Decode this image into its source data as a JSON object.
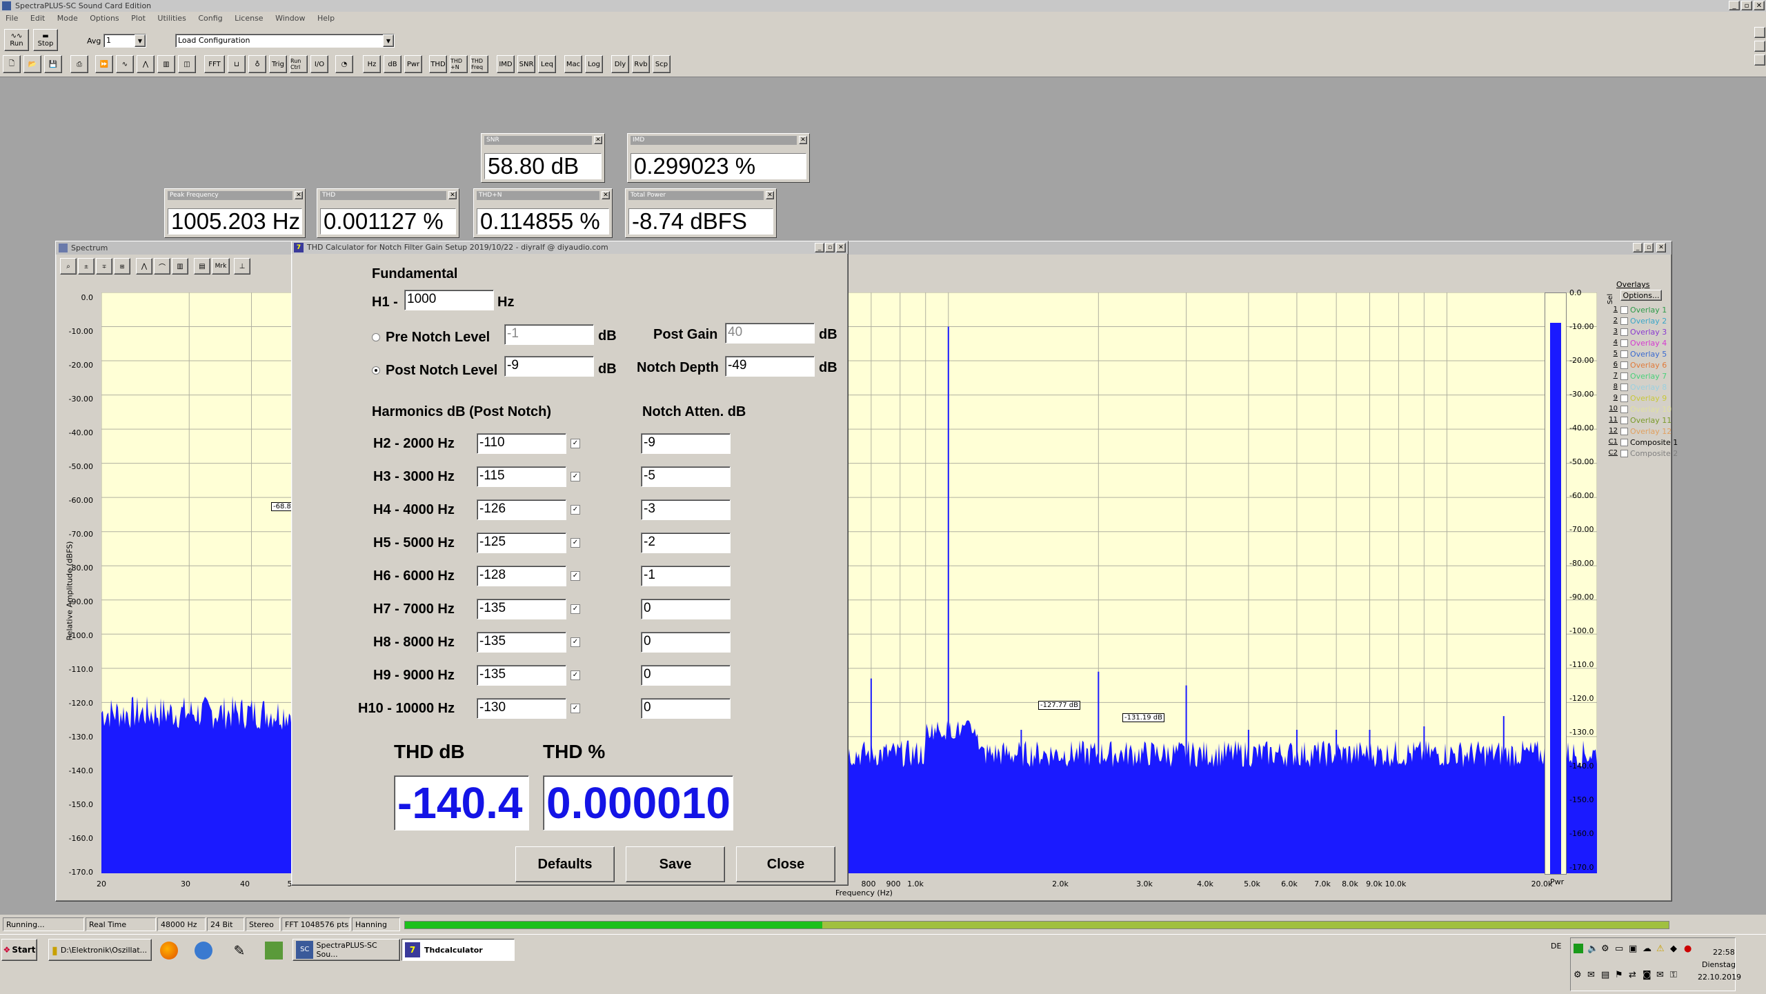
{
  "app_title": "SpectraPLUS-SC Sound Card Edition",
  "menu": [
    "File",
    "Edit",
    "Mode",
    "Options",
    "Plot",
    "Utilities",
    "Config",
    "License",
    "Window",
    "Help"
  ],
  "toolbar": {
    "run_label": "Run",
    "stop_label": "Stop",
    "avg_label": "Avg",
    "avg_value": "1",
    "config_value": "Load Configuration",
    "buttons": [
      "FFT",
      "Trig",
      "Run Ctrl",
      "I/O",
      "Hz",
      "dB",
      "Pwr",
      "THD",
      "THD +N",
      "THD Freq",
      "IMD",
      "SNR",
      "Leq",
      "Mac",
      "Log",
      "Dly",
      "Rvb",
      "Scp"
    ]
  },
  "meters": {
    "snr": {
      "title": "SNR",
      "value": "58.80 dB"
    },
    "imd": {
      "title": "IMD",
      "value": "0.299023 %"
    },
    "peak": {
      "title": "Peak Frequency",
      "value": "1005.203 Hz"
    },
    "thd": {
      "title": "THD",
      "value": "0.001127 %"
    },
    "thdn": {
      "title": "THD+N",
      "value": "0.114855 %"
    },
    "power": {
      "title": "Total Power",
      "value": "-8.74 dBFS"
    }
  },
  "spectrum": {
    "title": "Spectrum",
    "ylabel": "Relative Amplitude (dBFS)",
    "xlabel": "Frequency (Hz)",
    "yticks": [
      "0.0",
      "-10.00",
      "-20.00",
      "-30.00",
      "-40.00",
      "-50.00",
      "-60.00",
      "-70.00",
      "-80.00",
      "-90.00",
      "-100.0",
      "-110.0",
      "-120.0",
      "-130.0",
      "-140.0",
      "-150.0",
      "-160.0",
      "-170.0"
    ],
    "xticks_left": [
      "20",
      "30",
      "40",
      "5"
    ],
    "xticks_right": [
      "800",
      "900",
      "1.0k",
      "2.0k",
      "3.0k",
      "4.0k",
      "5.0k",
      "6.0k",
      "7.0k",
      "8.0k",
      "9.0k",
      "10.0k",
      "20.0k"
    ],
    "markers": [
      "-68.8",
      "-127.77 dB",
      "-131.19 dB"
    ],
    "pwr_label": "Pwr",
    "toolbar_buttons": [
      "Mrk"
    ]
  },
  "overlays": {
    "header": "Overlays",
    "options": "Options...",
    "sel_label": "Sel",
    "items": [
      {
        "num": "1",
        "name": "Overlay 1",
        "color": "#2e9a4a"
      },
      {
        "num": "2",
        "name": "Overlay 2",
        "color": "#3aa6c8"
      },
      {
        "num": "3",
        "name": "Overlay 3",
        "color": "#8a3ad0"
      },
      {
        "num": "4",
        "name": "Overlay 4",
        "color": "#d43ad0"
      },
      {
        "num": "5",
        "name": "Overlay 5",
        "color": "#3a6ad0"
      },
      {
        "num": "6",
        "name": "Overlay 6",
        "color": "#e07a3a"
      },
      {
        "num": "7",
        "name": "Overlay 7",
        "color": "#4ad07a"
      },
      {
        "num": "8",
        "name": "Overlay 8",
        "color": "#9ad0e0"
      },
      {
        "num": "9",
        "name": "Overlay 9",
        "color": "#c8c83a"
      },
      {
        "num": "10",
        "name": "Overlay 10",
        "color": "#e0e0a0"
      },
      {
        "num": "11",
        "name": "Overlay 11",
        "color": "#7a9a2a"
      },
      {
        "num": "12",
        "name": "Overlay 12",
        "color": "#e0a060"
      },
      {
        "num": "C1",
        "name": "Composite 1",
        "color": "#000000"
      },
      {
        "num": "C2",
        "name": "Composite 2",
        "color": "#808080"
      }
    ]
  },
  "dialog": {
    "title": "THD Calculator for Notch Filter Gain Setup 2019/10/22 - diyralf @ diyaudio.com",
    "fundamental_label": "Fundamental",
    "h1_label": "H1 -",
    "h1_value": "1000",
    "hz_unit": "Hz",
    "pre_notch_label": "Pre Notch Level",
    "pre_notch_value": "-1",
    "post_notch_label": "Post Notch Level",
    "post_notch_value": "-9",
    "db_unit": "dB",
    "post_gain_label": "Post Gain",
    "post_gain_value": "40",
    "notch_depth_label": "Notch Depth",
    "notch_depth_value": "-49",
    "harmonics_header": "Harmonics dB (Post Notch)",
    "notch_atten_header": "Notch Atten. dB",
    "harmonics": [
      {
        "label": "H2 - 2000 Hz",
        "value": "-110",
        "atten": "-9"
      },
      {
        "label": "H3 - 3000 Hz",
        "value": "-115",
        "atten": "-5"
      },
      {
        "label": "H4 - 4000 Hz",
        "value": "-126",
        "atten": "-3"
      },
      {
        "label": "H5 - 5000 Hz",
        "value": "-125",
        "atten": "-2"
      },
      {
        "label": "H6 - 6000 Hz",
        "value": "-128",
        "atten": "-1"
      },
      {
        "label": "H7 - 7000 Hz",
        "value": "-135",
        "atten": "0"
      },
      {
        "label": "H8 - 8000 Hz",
        "value": "-135",
        "atten": "0"
      },
      {
        "label": "H9 - 9000 Hz",
        "value": "-135",
        "atten": "0"
      },
      {
        "label": "H10 - 10000 Hz",
        "value": "-130",
        "atten": "0"
      }
    ],
    "thd_db_label": "THD dB",
    "thd_pct_label": "THD %",
    "thd_db_value": "-140.4",
    "thd_pct_value": "0.000010",
    "defaults_label": "Defaults",
    "save_label": "Save",
    "close_label": "Close"
  },
  "statusbar": [
    "Running...",
    "Real Time",
    "48000 Hz",
    "24 Bit",
    "Stereo",
    "FFT 1048576 pts",
    "Hanning"
  ],
  "taskbar": {
    "start": "Start",
    "items": [
      "D:\\Elektronik\\Oszillat...",
      "SpectraPLUS-SC Sou...",
      "Thdcalculator"
    ],
    "lang": "DE",
    "time": "22:58",
    "day": "Dienstag",
    "date": "22.10.2019"
  }
}
